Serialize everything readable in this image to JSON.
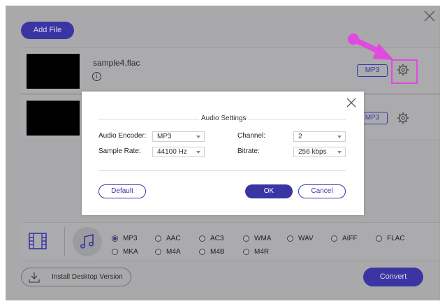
{
  "toolbar": {
    "add_file": "Add File"
  },
  "files": [
    {
      "name": "sample4.flac",
      "format": "MP3",
      "info_icon": "i"
    },
    {
      "name": "",
      "format": "MP3"
    }
  ],
  "formats": {
    "row1": [
      "MP3",
      "AAC",
      "AC3",
      "WMA",
      "WAV",
      "AIFF",
      "FLAC"
    ],
    "row2": [
      "MKA",
      "M4A",
      "M4B",
      "M4R"
    ],
    "selected": "MP3"
  },
  "footer": {
    "install": "Install Desktop Version",
    "convert": "Convert"
  },
  "dialog": {
    "title": "Audio Settings",
    "encoder_label": "Audio Encoder:",
    "encoder_value": "MP3",
    "channel_label": "Channel:",
    "channel_value": "2",
    "samplerate_label": "Sample Rate:",
    "samplerate_value": "44100 Hz",
    "bitrate_label": "Bitrate:",
    "bitrate_value": "256 kbps",
    "default_btn": "Default",
    "ok_btn": "OK",
    "cancel_btn": "Cancel"
  },
  "colors": {
    "accent": "#3a35a3",
    "highlight": "#e04ae0",
    "overlay": "#a9a9ab"
  }
}
